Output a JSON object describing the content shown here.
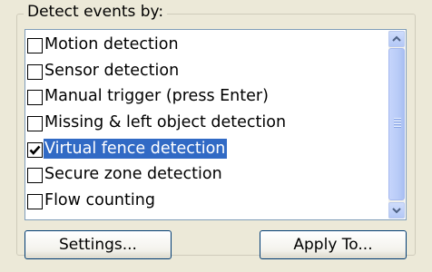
{
  "group": {
    "title": "Detect events by:"
  },
  "events": {
    "items": [
      {
        "label": "Motion detection",
        "checked": false,
        "selected": false
      },
      {
        "label": "Sensor detection",
        "checked": false,
        "selected": false
      },
      {
        "label": "Manual trigger (press Enter)",
        "checked": false,
        "selected": false
      },
      {
        "label": "Missing & left object detection",
        "checked": false,
        "selected": false
      },
      {
        "label": "Virtual fence detection",
        "checked": true,
        "selected": true
      },
      {
        "label": "Secure zone detection",
        "checked": false,
        "selected": false
      },
      {
        "label": "Flow counting",
        "checked": false,
        "selected": false
      }
    ]
  },
  "buttons": {
    "settings_label": "Settings...",
    "apply_label": "Apply To..."
  },
  "icons": {
    "scroll_up": "chevron-up-icon",
    "scroll_down": "chevron-down-icon",
    "check": "checkmark-icon"
  },
  "colors": {
    "selection": "#316ac5",
    "background": "#ece9d8",
    "list_border": "#7f9db9"
  }
}
